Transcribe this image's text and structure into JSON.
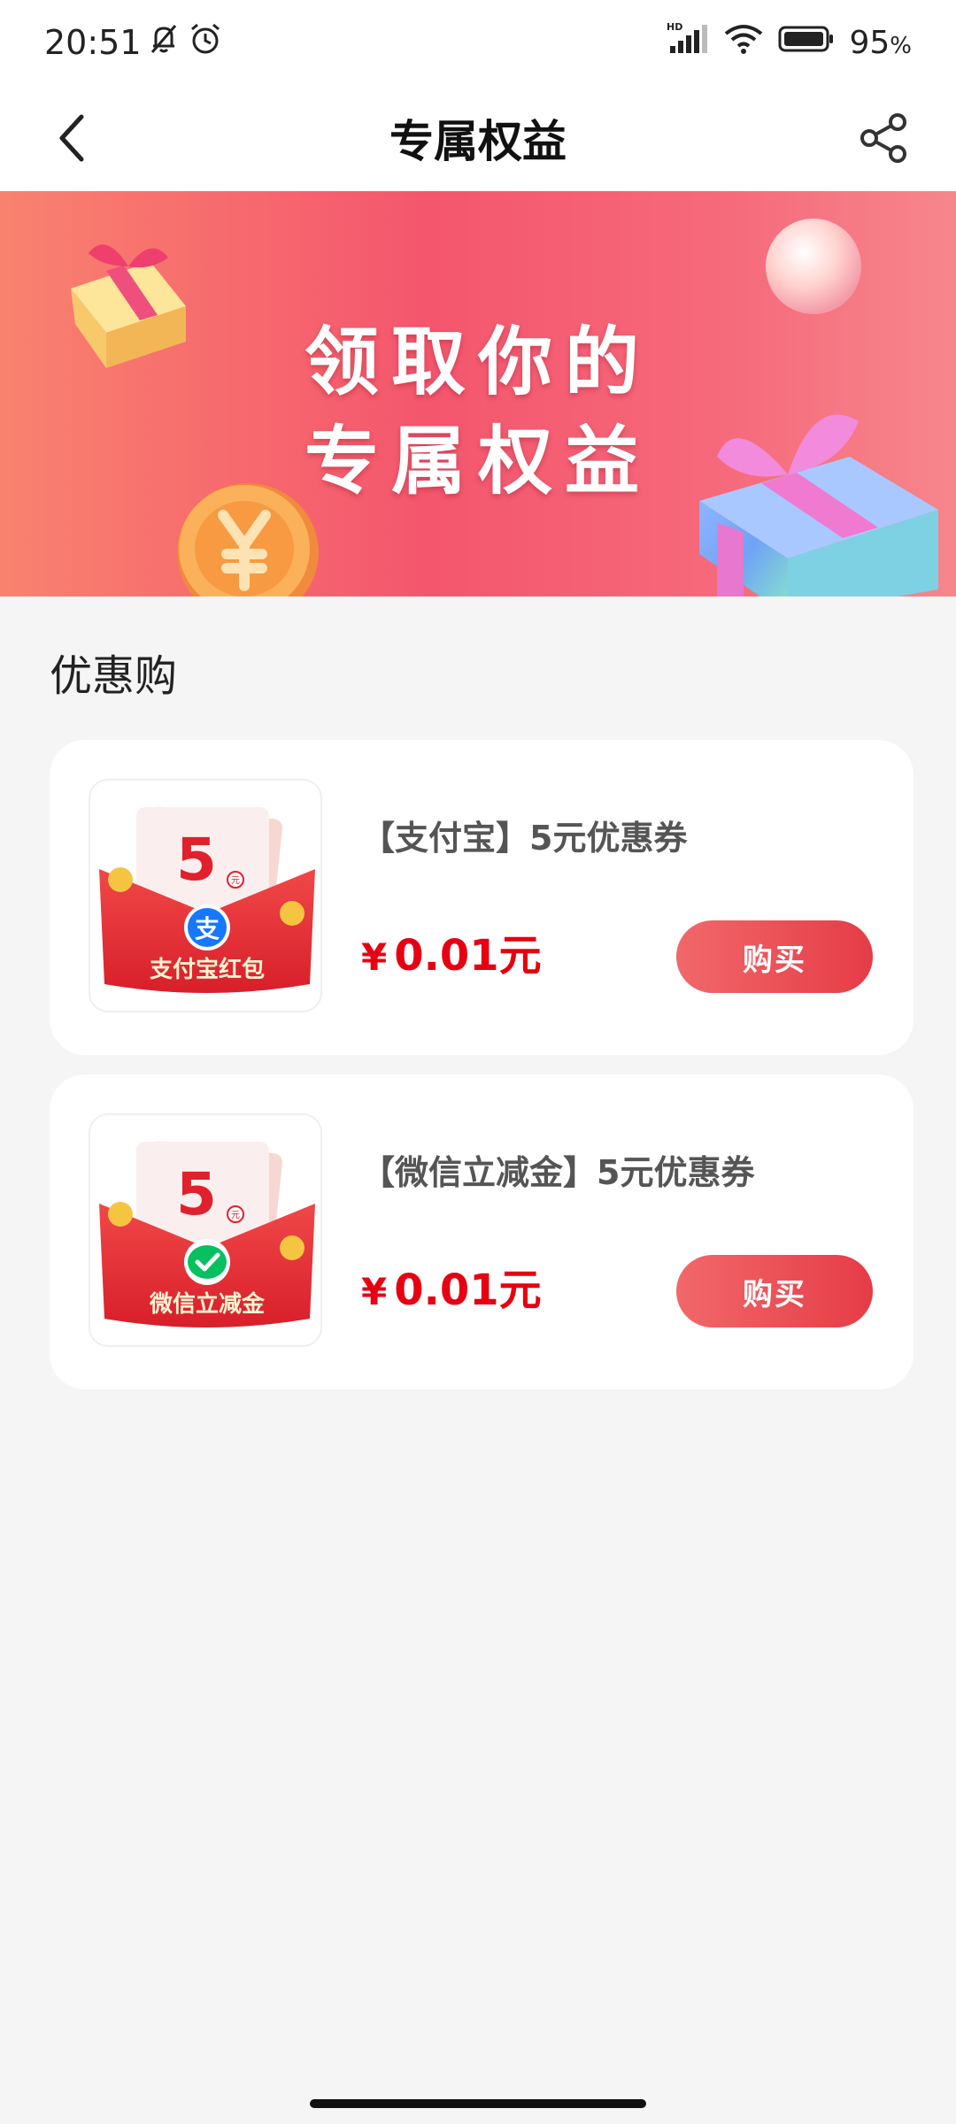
{
  "status_bar": {
    "time": "20:51",
    "network_label": "HD",
    "battery_percent": "95",
    "battery_unit": "%"
  },
  "nav": {
    "title": "专属权益"
  },
  "banner": {
    "line1": "领取你的",
    "line2": "专属权益"
  },
  "section": {
    "title": "优惠购"
  },
  "products": [
    {
      "name": "【支付宝】5元优惠券",
      "price_symbol": "¥",
      "price": "0.01元",
      "buy_label": "购买",
      "thumb_amount": "5",
      "thumb_unit": "元",
      "thumb_caption": "支付宝红包",
      "thumb_badge": "支",
      "badge_color": "#1677ff"
    },
    {
      "name": "【微信立减金】5元优惠券",
      "price_symbol": "¥",
      "price": "0.01元",
      "buy_label": "购买",
      "thumb_amount": "5",
      "thumb_unit": "元",
      "thumb_caption": "微信立减金",
      "thumb_badge": "",
      "badge_color": "#07c160"
    }
  ],
  "colors": {
    "accent": "#e60012",
    "button_start": "#f1686a",
    "button_end": "#e63c47",
    "background": "#f5f5f5"
  }
}
